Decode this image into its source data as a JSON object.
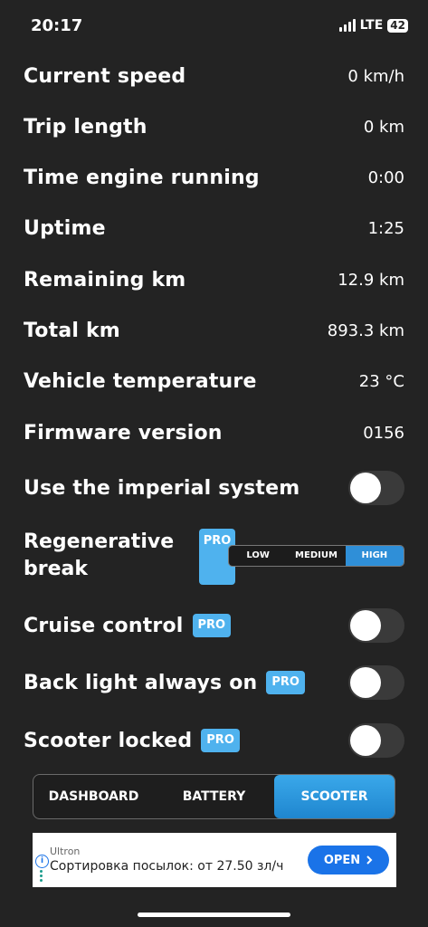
{
  "status": {
    "time": "20:17",
    "network": "LTE",
    "battery": "42"
  },
  "stats": [
    {
      "label": "Current speed",
      "value": "0 km/h"
    },
    {
      "label": "Trip length",
      "value": "0 km"
    },
    {
      "label": "Time engine running",
      "value": "0:00"
    },
    {
      "label": "Uptime",
      "value": "1:25"
    },
    {
      "label": "Remaining km",
      "value": "12.9 km"
    },
    {
      "label": "Total km",
      "value": "893.3 km"
    },
    {
      "label": "Vehicle temperature",
      "value": "23 °C"
    },
    {
      "label": "Firmware version",
      "value": "0156"
    }
  ],
  "settings": {
    "imperial": {
      "label": "Use the imperial system",
      "on": false
    },
    "regen": {
      "label_line1": "Regenerative",
      "label_line2": "break",
      "pro": "PRO",
      "options": [
        "LOW",
        "MEDIUM",
        "HIGH"
      ],
      "selected": "HIGH"
    },
    "cruise": {
      "label": "Cruise control",
      "pro": "PRO",
      "on": false
    },
    "backlight": {
      "label": "Back light always on",
      "pro": "PRO",
      "on": false
    },
    "locked": {
      "label": "Scooter locked",
      "pro": "PRO",
      "on": false
    }
  },
  "nav": {
    "tabs": [
      "DASHBOARD",
      "BATTERY",
      "SCOOTER"
    ],
    "active": "SCOOTER"
  },
  "ad": {
    "brand": "Ultron",
    "text": "Сортировка посылок: от 27.50 зл/ч",
    "button": "OPEN",
    "info_icon": "i"
  },
  "colors": {
    "background": "#232323",
    "accent": "#4fb2ee",
    "active_tab": "#2f8fd8",
    "ad_button": "#1a73e8"
  }
}
